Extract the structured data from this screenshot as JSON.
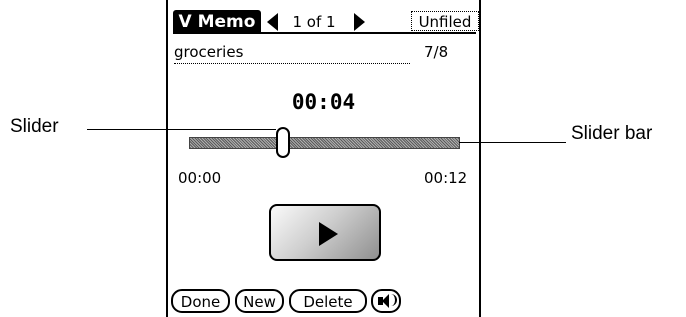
{
  "app": {
    "title": "V Memo",
    "record_count": "1 of 1",
    "category": "Unfiled"
  },
  "memo": {
    "name": "groceries",
    "date": "7/8"
  },
  "player": {
    "current_time": "00:04",
    "start_time": "00:00",
    "end_time": "00:12",
    "playback_progress": 0.33
  },
  "buttons": {
    "done": "Done",
    "new": "New",
    "delete": "Delete"
  },
  "callouts": {
    "slider": "Slider",
    "slider_bar": "Slider bar"
  },
  "icons": {
    "nav_prev": "left-arrow-icon",
    "nav_next": "right-arrow-icon",
    "play": "play-icon",
    "volume": "speaker-icon"
  }
}
